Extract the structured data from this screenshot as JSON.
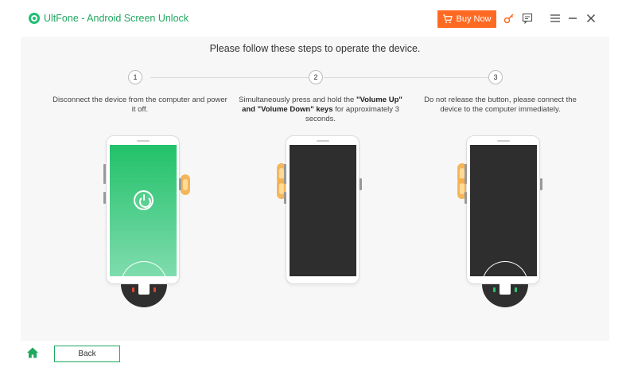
{
  "app": {
    "title": "UltFone - Android Screen Unlock",
    "brand_color": "#1fa85f",
    "buy_button_label": "Buy Now",
    "buy_button_color": "#ff6a22"
  },
  "toolbar": {
    "icons": [
      "cart-icon",
      "key-icon",
      "feedback-icon",
      "menu-icon",
      "minimize-icon",
      "close-icon"
    ]
  },
  "main": {
    "heading": "Please follow these steps to operate the device.",
    "steps": [
      {
        "number": "1",
        "text": "Disconnect the device from the computer and power it off."
      },
      {
        "number": "2",
        "text_prefix": "Simultaneously press and hold the ",
        "text_bold": "\"Volume Up\" and \"Volume Down\" keys",
        "text_suffix": " for approximately 3 seconds."
      },
      {
        "number": "3",
        "text": "Do not release the button, please connect the device to the computer immediately."
      }
    ],
    "phones": [
      {
        "screen": "green",
        "icon": "power-icon",
        "cable_led_color": "#e0452c"
      },
      {
        "screen": "dark"
      },
      {
        "screen": "dark",
        "cable_led_color": "#28c46e"
      }
    ]
  },
  "footer": {
    "home_icon": "home-icon",
    "back_label": "Back"
  }
}
